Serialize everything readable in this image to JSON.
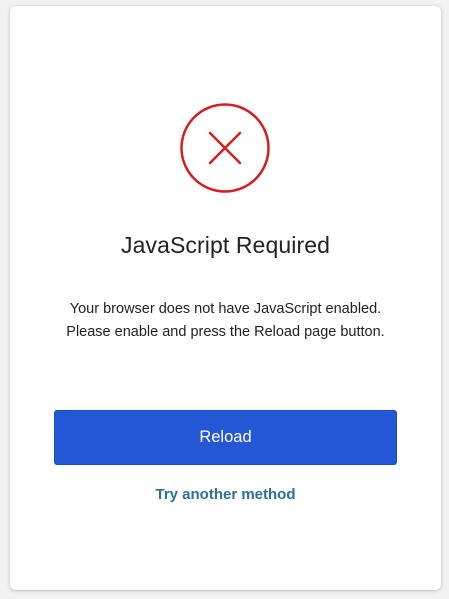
{
  "dialog": {
    "icon": "error-x-circle-icon",
    "icon_color": "#d21f1f",
    "title": "JavaScript Required",
    "message": "Your browser does not have JavaScript enabled. Please enable and press the Reload page button.",
    "reload_label": "Reload",
    "alt_method_label": "Try another method"
  },
  "colors": {
    "accent": "#2457d6",
    "link": "#2d6e9a",
    "error": "#d21f1f"
  }
}
